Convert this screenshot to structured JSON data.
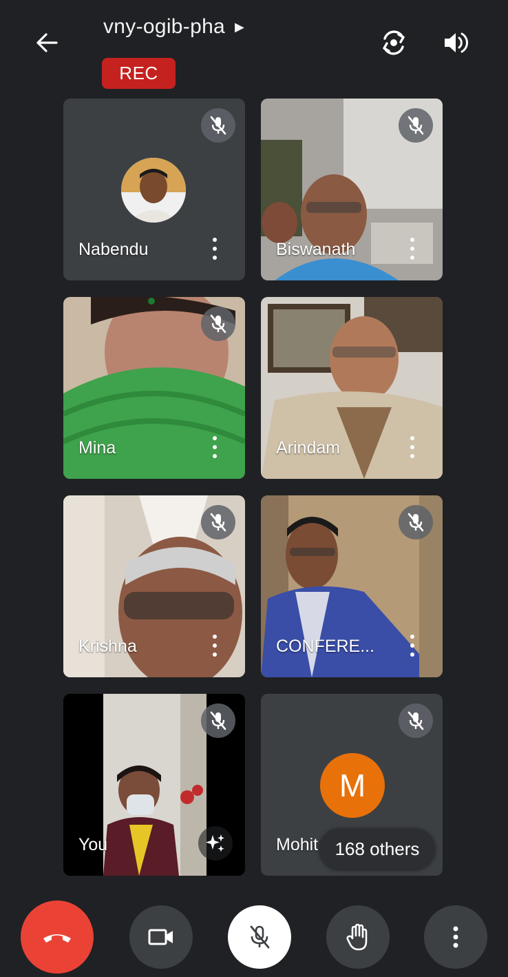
{
  "header": {
    "meeting_code": "vny-ogib-pha",
    "rec_label": "REC"
  },
  "tiles": [
    {
      "name": "Nabendu",
      "muted": true
    },
    {
      "name": "Biswanath",
      "muted": true
    },
    {
      "name": "Mina",
      "muted": true
    },
    {
      "name": "Arindam",
      "muted": false
    },
    {
      "name": "Krishna",
      "muted": true
    },
    {
      "name": "CONFERE...",
      "muted": true
    },
    {
      "name": "You",
      "muted": true
    },
    {
      "name": "Mohit",
      "muted": true,
      "initial": "M"
    }
  ],
  "others_label": "168 others",
  "colors": {
    "background": "#202124",
    "tile": "#3c4043",
    "rec": "#c5221f",
    "end_call": "#ea4335",
    "avatar_orange": "#e8710a"
  },
  "icons": {
    "back": "arrow-left-icon",
    "camera_switch": "camera-switch-icon",
    "speaker": "speaker-icon",
    "mic_off": "mic-off-icon",
    "more": "more-vertical-icon",
    "end_call": "call-end-icon",
    "video": "video-camera-icon",
    "hand": "raise-hand-icon",
    "effects": "sparkle-icon"
  }
}
